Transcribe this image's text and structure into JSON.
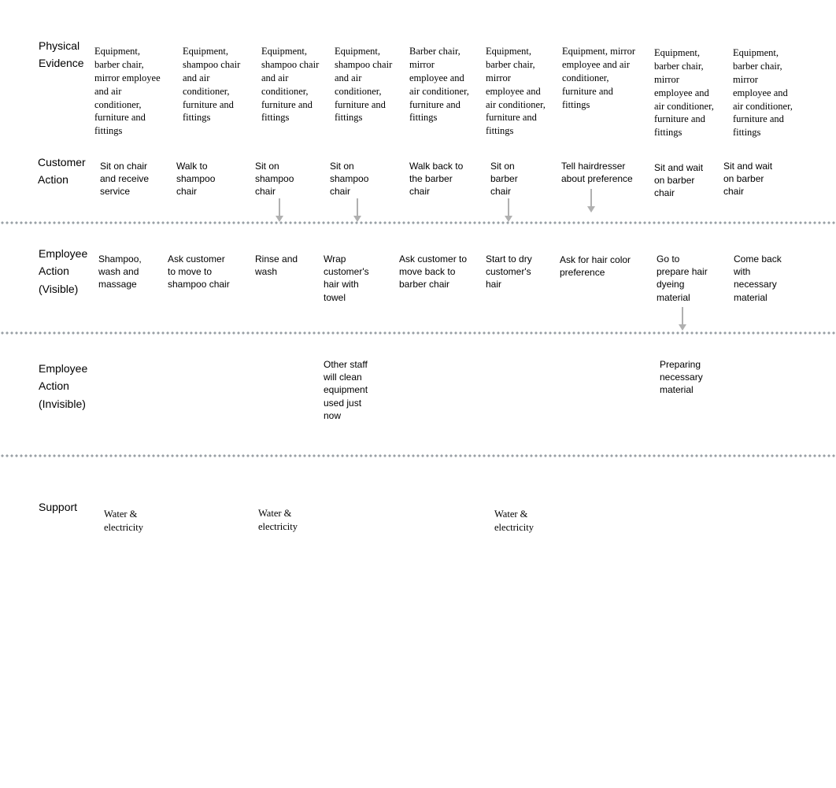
{
  "rows": {
    "physical_evidence": "Physical Evidence",
    "customer_action": "Customer Action",
    "employee_visible": "Employee Action (Visible)",
    "employee_invisible": "Employee Action (Invisible)",
    "support": "Support"
  },
  "physical_evidence": [
    "Equipment, barber chair, mirror employee and air conditioner, furniture and fittings",
    "Equipment, shampoo chair and air conditioner, furniture and fittings",
    "Equipment, shampoo chair and air conditioner, furniture and fittings",
    "Equipment, shampoo chair and air conditioner, furniture and fittings",
    "Barber chair, mirror employee and air conditioner, furniture and fittings",
    "Equipment, barber chair, mirror employee and air conditioner, furniture and fittings",
    "Equipment, mirror employee and air conditioner, furniture and fittings",
    "Equipment, barber chair, mirror employee and air conditioner, furniture and fittings",
    "Equipment, barber chair, mirror employee and air conditioner, furniture and fittings"
  ],
  "customer_action": [
    "Sit on chair and receive service",
    "Walk to shampoo chair",
    "Sit on shampoo chair",
    "Sit on shampoo chair",
    "Walk back to the barber chair",
    "Sit on barber chair",
    "Tell hairdresser about preference",
    "Sit and wait on barber chair",
    "Sit and wait on barber chair"
  ],
  "employee_visible": [
    "Shampoo, wash and massage",
    "Ask customer to move to shampoo chair",
    "Rinse and wash",
    "Wrap customer's hair with towel",
    "Ask customer to move back to barber chair",
    "Start to dry customer's hair",
    "Ask for hair color preference",
    "Go to prepare hair dyeing material",
    "Come back with necessary material"
  ],
  "employee_invisible": {
    "3": "Other staff will clean equipment used just now",
    "7": "Preparing necessary material"
  },
  "support": {
    "0": "Water & electricity",
    "2": "Water & electricity",
    "5": "Water & electricity"
  }
}
